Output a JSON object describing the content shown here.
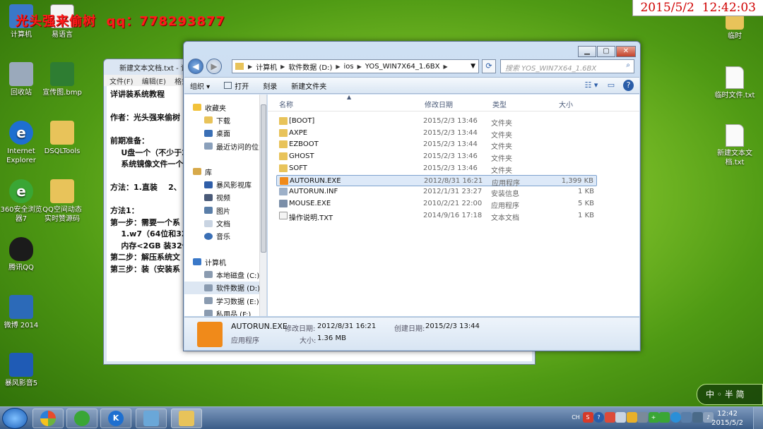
{
  "overlay": {
    "watermark": "光头强来偷树  qq：778293877",
    "datetime": "2015/5/2  12:42:03"
  },
  "desktop_left": [
    {
      "label": "计算机",
      "color": "#3a78c8"
    },
    {
      "label": "易语言",
      "color": "#f4f4f4"
    },
    {
      "label": "回收站",
      "color": "#9aa9bb"
    },
    {
      "label": "宣传图.bmp",
      "color": "#2e7d32"
    },
    {
      "label": "Internet Explorer",
      "color": "#1e6fd0"
    },
    {
      "label": "DSQLTools",
      "color": "#e8c35a"
    },
    {
      "label": "360安全浏览器7",
      "color": "#3aa635"
    },
    {
      "label": "QQ空间动态实时赞源码",
      "color": "#e8c35a"
    },
    {
      "label": "腾讯QQ",
      "color": "#1b1b1b"
    },
    {
      "label": "微博 2014",
      "color": "#2c6ab8"
    },
    {
      "label": "暴风影音5",
      "color": "#1f5bb5"
    }
  ],
  "desktop_right": [
    {
      "label": "临时"
    },
    {
      "label": "临时文件.txt"
    },
    {
      "label": "新建文本文档.txt"
    }
  ],
  "notepad": {
    "title": "新建文本文档.txt - 记",
    "menu": [
      "文件(F)",
      "编辑(E)",
      "格式"
    ],
    "lines": [
      "详讲装系统教程",
      "",
      "作者：光头强来偷树",
      "",
      "前期准备：",
      "    U盘一个（不少于2",
      "    系统镜像文件一个",
      "",
      "方法：1.直装    2、",
      "",
      "方法1：",
      "第一步：需要一个系",
      "    1.w7（64位和32",
      "    内存<2GB 装32位",
      "第二步：解压系统文",
      "第三步：装（安装系"
    ]
  },
  "explorer": {
    "path": [
      "计算机",
      "软件数据 (D:)",
      "ios",
      "YOS_WIN7X64_1.6BX"
    ],
    "search_placeholder": "搜索 YOS_WIN7X64_1.6BX",
    "toolbar": [
      "组织 ▾",
      "打开",
      "刻录",
      "新建文件夹"
    ],
    "nav": {
      "favorites": "收藏夹",
      "fav_items": [
        "下载",
        "桌面",
        "最近访问的位置"
      ],
      "libraries": "库",
      "lib_items": [
        "暴风影视库",
        "视频",
        "图片",
        "文档",
        "音乐"
      ],
      "computer": "计算机",
      "drives": [
        "本地磁盘 (C:)",
        "软件数据 (D:)",
        "学习数据 (E:)",
        "私用品 (F:)"
      ]
    },
    "columns": {
      "name": "名称",
      "date": "修改日期",
      "type": "类型",
      "size": "大小"
    },
    "files": [
      {
        "name": "[BOOT]",
        "date": "2015/2/3 13:46",
        "type": "文件夹",
        "size": "",
        "color": "#e8c35a"
      },
      {
        "name": "AXPE",
        "date": "2015/2/3 13:44",
        "type": "文件夹",
        "size": "",
        "color": "#e8c35a"
      },
      {
        "name": "EZBOOT",
        "date": "2015/2/3 13:44",
        "type": "文件夹",
        "size": "",
        "color": "#e8c35a"
      },
      {
        "name": "GHOST",
        "date": "2015/2/3 13:46",
        "type": "文件夹",
        "size": "",
        "color": "#e8c35a"
      },
      {
        "name": "SOFT",
        "date": "2015/2/3 13:46",
        "type": "文件夹",
        "size": "",
        "color": "#e8c35a"
      },
      {
        "name": "AUTORUN.EXE",
        "date": "2012/8/31 16:21",
        "type": "应用程序",
        "size": "1,399 KB",
        "color": "#f08a1a"
      },
      {
        "name": "AUTORUN.INF",
        "date": "2012/1/31 23:27",
        "type": "安装信息",
        "size": "1 KB",
        "color": "#9db0c8"
      },
      {
        "name": "MOUSE.EXE",
        "date": "2010/2/21 22:00",
        "type": "应用程序",
        "size": "5 KB",
        "color": "#7a8ea8"
      },
      {
        "name": "操作说明.TXT",
        "date": "2014/9/16 17:18",
        "type": "文本文档",
        "size": "1 KB",
        "color": "#f4f4f4"
      }
    ],
    "details": {
      "name": "AUTORUN.EXE",
      "modified_label": "修改日期:",
      "modified": "2012/8/31 16:21",
      "created_label": "创建日期:",
      "created": "2015/2/3 13:44",
      "type": "应用程序",
      "size_label": "大小:",
      "size": "1.36 MB"
    }
  },
  "taskbar": {
    "clock_time": "12:42",
    "clock_date": "2015/5/2",
    "tray_lang": "CH",
    "ime_text": "中 ◦ 半 简"
  }
}
